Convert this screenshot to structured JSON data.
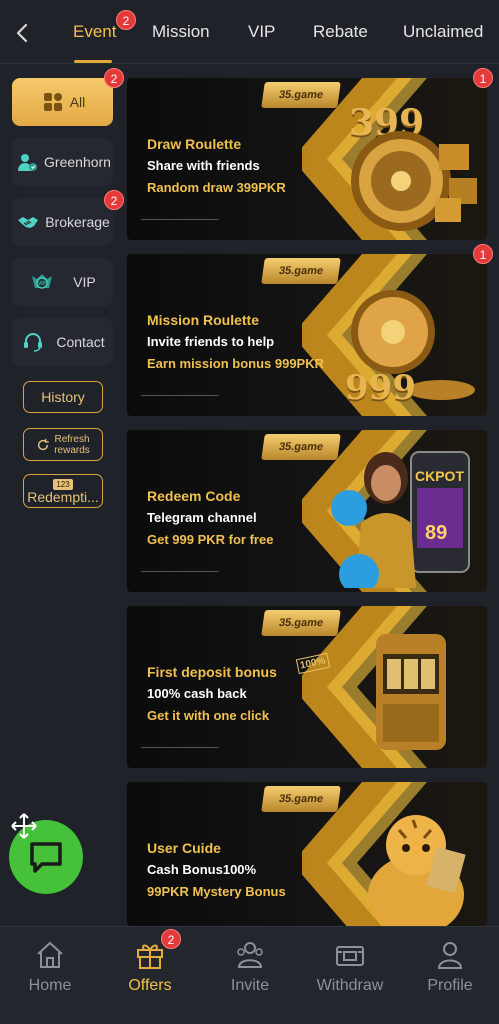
{
  "top_tabs": [
    {
      "label": "Event",
      "badge": "2",
      "active": true
    },
    {
      "label": "Mission"
    },
    {
      "label": "VIP"
    },
    {
      "label": "Rebate"
    },
    {
      "label": "Unclaimed"
    }
  ],
  "sidebar": {
    "items": [
      {
        "label": "All",
        "badge": "2",
        "icon": "grid-icon",
        "active": true
      },
      {
        "label": "Greenhorn",
        "icon": "newbie-icon"
      },
      {
        "label": "Brokerage",
        "badge": "2",
        "icon": "handshake-icon"
      },
      {
        "label": "VIP",
        "icon": "vip-shield-icon"
      },
      {
        "label": "Contact",
        "icon": "headset-icon"
      }
    ],
    "history_label": "History",
    "refresh_label_1": "Refresh",
    "refresh_label_2": "rewards",
    "redemption_label": "Redempti...",
    "redemption_code_badge": "123"
  },
  "banners": [
    {
      "line1": "Draw Roulette",
      "line2": "Share with friends",
      "line3": "Random draw 399PKR",
      "logo": "35.game",
      "art_number": "399",
      "badge": "1"
    },
    {
      "line1": "Mission Roulette",
      "line2": "Invite friends to help",
      "line3": "Earn mission bonus 999PKR",
      "logo": "35.game",
      "art_number": "999",
      "badge": "1"
    },
    {
      "line1": "Redeem Code",
      "line2": "Telegram channel",
      "line3": "Get 999 PKR for free",
      "logo": "35.game",
      "art_text": "CKPOT",
      "art_digits": "89"
    },
    {
      "line1": "First deposit bonus",
      "line2": "100% cash back",
      "line3": "Get it with one click",
      "logo": "35.game",
      "art_percent": "100%"
    },
    {
      "line1": "User Cuide",
      "line2": "Cash Bonus100%",
      "line3": "99PKR Mystery Bonus",
      "logo": "35.game"
    }
  ],
  "bottom_nav": [
    {
      "label": "Home",
      "icon": "home-icon"
    },
    {
      "label": "Offers",
      "icon": "gift-icon",
      "badge": "2",
      "active": true
    },
    {
      "label": "Invite",
      "icon": "invite-icon"
    },
    {
      "label": "Withdraw",
      "icon": "withdraw-icon"
    },
    {
      "label": "Profile",
      "icon": "profile-icon"
    }
  ],
  "colors": {
    "accent": "#f1c14a",
    "badge": "#e43a3a",
    "fab": "#45c23a",
    "background": "#1f2228"
  }
}
